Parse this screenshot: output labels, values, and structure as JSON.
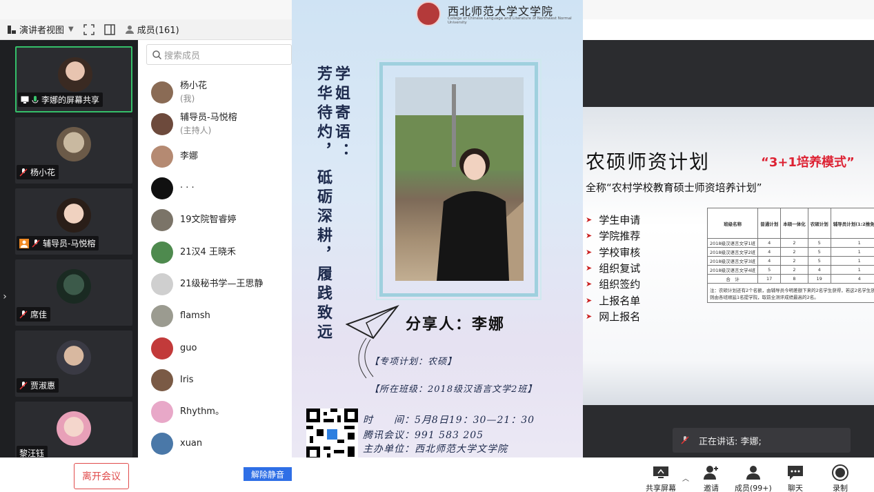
{
  "toolbar": {
    "view_label": "演讲者视图",
    "members_label": "成员(161)"
  },
  "video_tiles": [
    {
      "name": "李娜的屏幕共享",
      "active": true
    },
    {
      "name": "杨小花"
    },
    {
      "name": "辅导员-马悦榕"
    },
    {
      "name": "席佳"
    },
    {
      "name": "贾淑惠"
    },
    {
      "name": "黎汪钰"
    }
  ],
  "members": {
    "search_placeholder": "搜索成员",
    "list": [
      {
        "name": "杨小花",
        "sub": "(我)",
        "color": "#8a6b55"
      },
      {
        "name": "辅导员-马悦榕",
        "sub": "(主持人)",
        "color": "#6d4a3c"
      },
      {
        "name": "李娜",
        "sub": "",
        "color": "#b58a72"
      },
      {
        "name": "· · ·",
        "sub": "",
        "color": "#101010"
      },
      {
        "name": "19文院智睿婷",
        "sub": "",
        "color": "#7b7468"
      },
      {
        "name": "21汉4 王晓禾",
        "sub": "",
        "color": "#4e8a4e"
      },
      {
        "name": "21级秘书学—王思静",
        "sub": "",
        "color": "#cfcfcf"
      },
      {
        "name": "flamsh",
        "sub": "",
        "color": "#9b9b90"
      },
      {
        "name": "guo",
        "sub": "",
        "color": "#c23a3a"
      },
      {
        "name": "Iris",
        "sub": "",
        "color": "#7a5a45"
      },
      {
        "name": "Rhythm。",
        "sub": "",
        "color": "#e8a8c8"
      },
      {
        "name": "xuan",
        "sub": "",
        "color": "#4a78a8"
      }
    ]
  },
  "poster": {
    "school": "西北师范大学文学院",
    "school_en": "College of Chinese Language and Literature of Northwest Normal University",
    "col1": "学姐寄语：",
    "col2": "芳华待灼，",
    "col3": "砥砺深耕，履践致远",
    "sharer": "分享人：李娜",
    "line1": "【专项计划：农硕】",
    "line2": "【所在班级：2018级汉语言文学2班】",
    "time": "时　　间：5月8日19：30—21：30",
    "meeting": "腾讯会议：991 583 205",
    "host": "主办单位：西北师范大学文学院"
  },
  "slide": {
    "title": "农硕师资计划",
    "mode": "“3+1培养模式”",
    "full_name": "全称“农村学校教育硕士师资培养计划”",
    "steps": [
      "学生申请",
      "学院推荐",
      "学校审核",
      "组织复试",
      "组织签约",
      "上报名单",
      "网上报名"
    ],
    "table": {
      "headers": [
        "班级名称",
        "普通计划",
        "本硕一体化",
        "农硕计划",
        "辅导员计划(1:2推免名额)"
      ],
      "rows": [
        [
          "2018级汉语言文学1班",
          "4",
          "2",
          "5",
          "1"
        ],
        [
          "2018级汉语言文学2班",
          "4",
          "2",
          "5",
          "1"
        ],
        [
          "2018级汉语言文学3班",
          "4",
          "2",
          "5",
          "1"
        ],
        [
          "2018级汉语言文学4班",
          "5",
          "2",
          "4",
          "1"
        ],
        [
          "合　计",
          "17",
          "8",
          "19",
          "4"
        ]
      ],
      "note": "注：农硕计划还有2个名额，由辅导员今明差额下来的2名学生获得，若这2名学生放弃，则由各班顺延1名提学院，取前全测评成绩最高的2名。"
    }
  },
  "speaking": {
    "label": "正在讲话: 李娜;"
  },
  "bottombar": {
    "leave": "离开会议",
    "unmute": "解除静音",
    "share": "共享屏幕",
    "invite": "邀请",
    "members": "成员(99+)",
    "chat": "聊天",
    "record": "录制"
  }
}
